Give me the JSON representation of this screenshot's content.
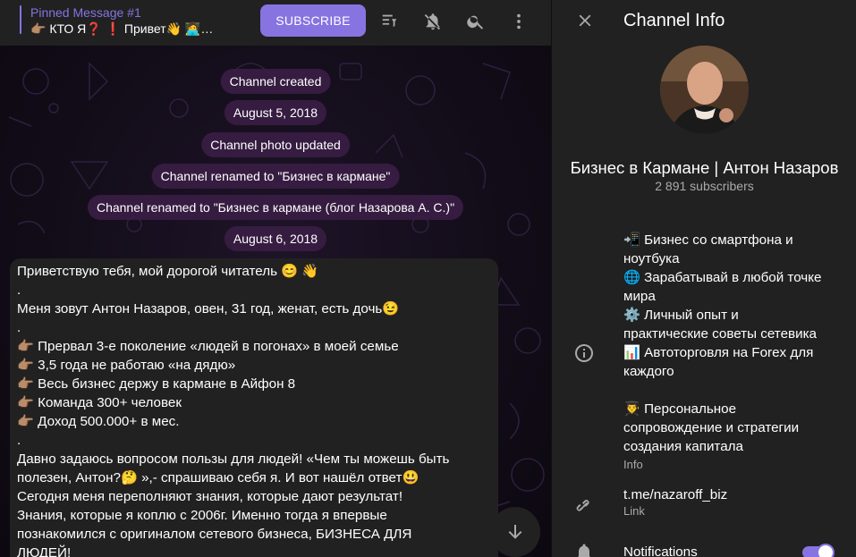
{
  "pinned": {
    "title": "Pinned Message #1",
    "text": "👉🏽 КТО Я❓ ❗️ Привет👋 🧑‍💻…"
  },
  "header": {
    "subscribe_label": "SUBSCRIBE",
    "icons": [
      "pinned-list-icon",
      "mute-icon",
      "search-icon",
      "more-icon"
    ]
  },
  "service_messages": [
    "Channel created",
    "August 5, 2018",
    "Channel photo updated",
    "Channel renamed to \"Бизнес в кармане\"",
    "Channel renamed to \"Бизнес в кармане (блог Назарова А. С.)\"",
    "August 6, 2018"
  ],
  "message": {
    "lines": [
      "Приветствую тебя, мой дорогой читатель 😊 👋",
      ".",
      "Меня зовут Антон Назаров, овен, 31 год, женат, есть дочь😉",
      ".",
      "👉🏽 Прервал 3-е поколение «людей в погонах» в моей семье",
      "👉🏽 3,5 года не работаю «на дядю»",
      "👉🏽 Весь бизнес держу в кармане в Айфон 8",
      "👉🏽 Команда 300+ человек",
      "👉🏽 Доход 500.000+ в мес.",
      ".",
      "Давно задаюсь вопросом пользы для людей! «Чем ты можешь быть",
      "полезен, Антон?🤔 »,- спрашиваю себя я. И вот нашёл ответ😃",
      "Сегодня меня переполняют знания, которые дают результат!",
      "Знания, которые я коплю с 2006г. Именно тогда я впервые",
      "познакомился с оригиналом сетевого бизнеса, БИЗНЕСА ДЛЯ",
      "ЛЮДЕЙ!"
    ]
  },
  "info": {
    "title": "Channel Info",
    "channel_name": "Бизнес в Кармане | Антон Назаров",
    "subscribers": "2 891 subscribers",
    "about_lines_1": [
      "📲 Бизнес со смартфона и",
      "ноутбука",
      "🌐 Зарабатывай в любой точке",
      "мира",
      "⚙️ Личный опыт и",
      "практические советы сетевика",
      "📊 Автоторговля на Forex для",
      "каждого"
    ],
    "about_lines_2": [
      "👨‍🎓 Персональное",
      "сопровождение и стратегии",
      "создания капитала"
    ],
    "about_label": "Info",
    "link": "t.me/nazaroff_biz",
    "link_label": "Link",
    "notifications_label": "Notifications",
    "notifications_on": true
  },
  "colors": {
    "accent": "#8774e1",
    "panel": "#212121",
    "muted": "#aaaaaa"
  }
}
